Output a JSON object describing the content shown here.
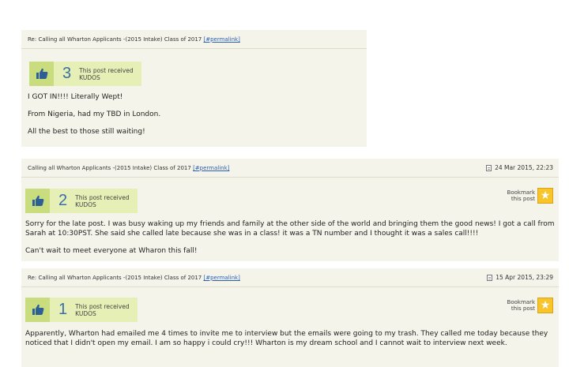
{
  "posts": [
    {
      "title": "Re: Calling all Wharton Applicants -(2015 Intake) Class of 2017",
      "permalink": "[#permalink]",
      "date": "",
      "kudos_count": "3",
      "kudos_text_1": "This post received",
      "kudos_text_2": "KUDOS",
      "bookmark": "",
      "body": [
        "I GOT IN!!!! Literally Wept!",
        "From Nigeria, had my TBD in London.",
        "All the best to those still waiting!"
      ]
    },
    {
      "title": "Calling all Wharton Applicants -(2015 Intake) Class of 2017",
      "permalink": "[#permalink]",
      "date": "24 Mar 2015, 22:23",
      "kudos_count": "2",
      "kudos_text_1": "This post received",
      "kudos_text_2": "KUDOS",
      "bookmark_1": "Bookmark",
      "bookmark_2": "this post",
      "body": [
        "Sorry for the late post. I was busy waking up my friends and family at the other side of the world and bringing them the good news! I got a call from Sarah at 10:30PST. She said she called late because she was in a class! it was a TN number and I thought it was a sales call!!!!",
        "Can't wait to meet everyone at Wharon this fall!"
      ]
    },
    {
      "title": "Re: Calling all Wharton Applicants -(2015 Intake) Class of 2017",
      "permalink": "[#permalink]",
      "date": "15 Apr 2015, 23:29",
      "kudos_count": "1",
      "kudos_text_1": "This post received",
      "kudos_text_2": "KUDOS",
      "bookmark_1": "Bookmark",
      "bookmark_2": "this post",
      "body": [
        "Apparently, Wharton had emailed me 4 times to invite me to interview but the emails were going to my trash. They called me today because they noticed that I didn't open my email. I am so happy i could cry!!! Wharton is my dream school and I cannot wait to interview next week."
      ]
    }
  ]
}
